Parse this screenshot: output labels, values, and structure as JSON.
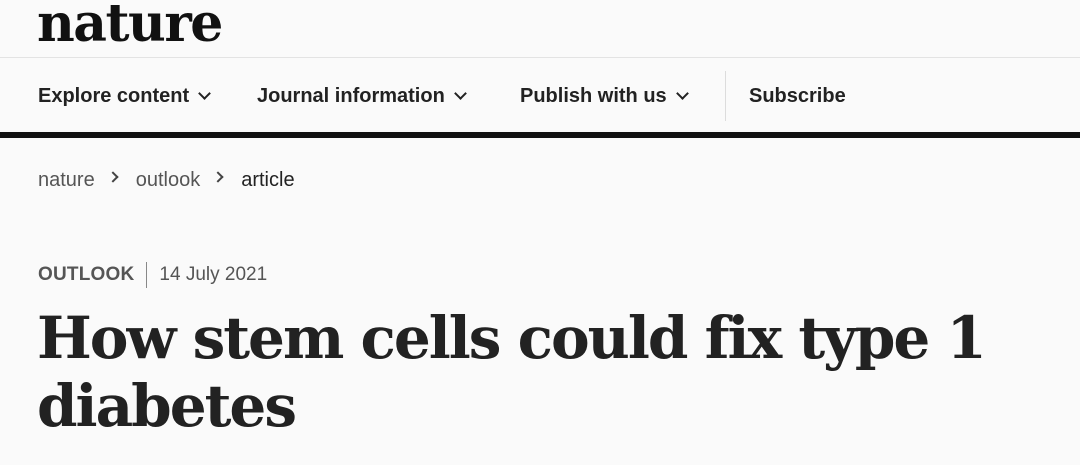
{
  "brand": {
    "logo_text": "nature"
  },
  "nav": {
    "items": [
      {
        "label": "Explore content",
        "has_dropdown": true,
        "icon": "chevron-down-icon"
      },
      {
        "label": "Journal information",
        "has_dropdown": true,
        "icon": "chevron-down-icon"
      },
      {
        "label": "Publish with us",
        "has_dropdown": true,
        "icon": "chevron-down-icon"
      }
    ],
    "subscribe_label": "Subscribe"
  },
  "breadcrumb": {
    "items": [
      "nature",
      "outlook",
      "article"
    ],
    "separator_icon": "chevron-right-icon"
  },
  "article": {
    "type": "OUTLOOK",
    "date": "14 July 2021",
    "title": "How stem cells could fix type 1 diabetes"
  },
  "colors": {
    "background": "#fafafa",
    "text": "#222222",
    "muted_text": "#555555",
    "nav_rule": "#111111"
  }
}
